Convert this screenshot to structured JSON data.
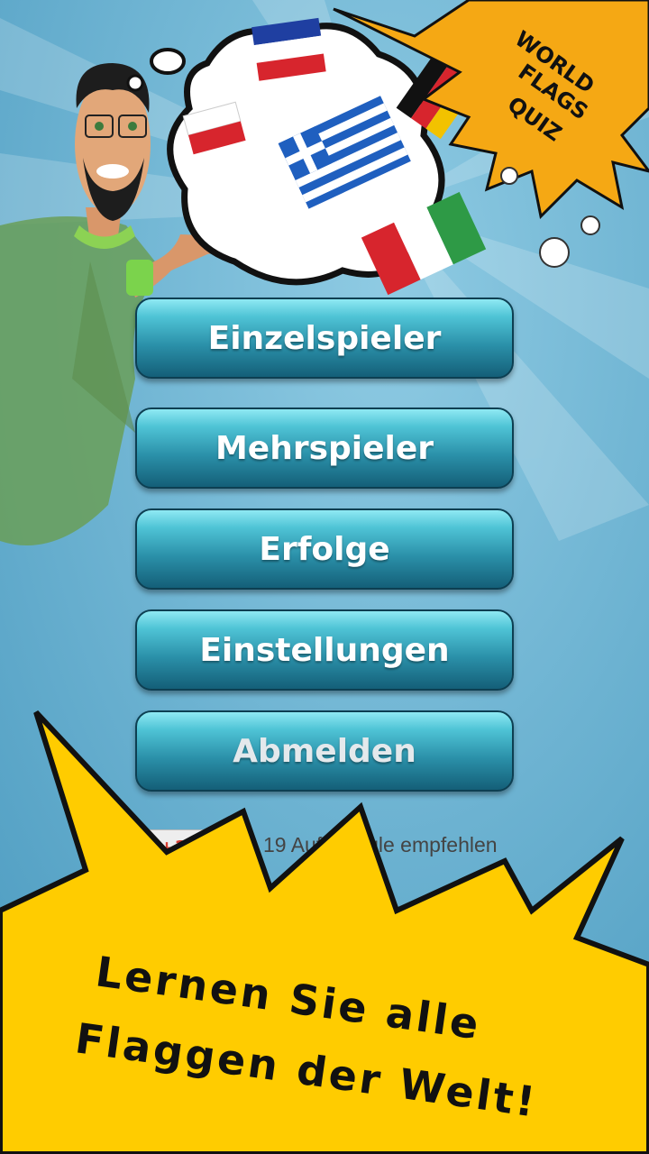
{
  "app": {
    "logo_line1": "WORLD",
    "logo_line2": "FLAGS",
    "logo_line3": "QUIZ"
  },
  "menu": {
    "single_player": "Einzelspieler",
    "multiplayer": "Mehrspieler",
    "achievements": "Erfolge",
    "settings": "Einstellungen",
    "logout": "Abmelden"
  },
  "google_plus": {
    "button_label": "+1",
    "text": "19 Auf Google empfehlen"
  },
  "banner": {
    "line1": "Lernen Sie alle",
    "line2": "Flaggen der Welt!"
  },
  "icons": [
    "character-illustration",
    "thought-cloud",
    "flag-icon",
    "comic-burst"
  ],
  "colors": {
    "accent_yellow": "#ffcc00",
    "button_teal": "#2a8fa8",
    "background": "#5aa6c9"
  }
}
